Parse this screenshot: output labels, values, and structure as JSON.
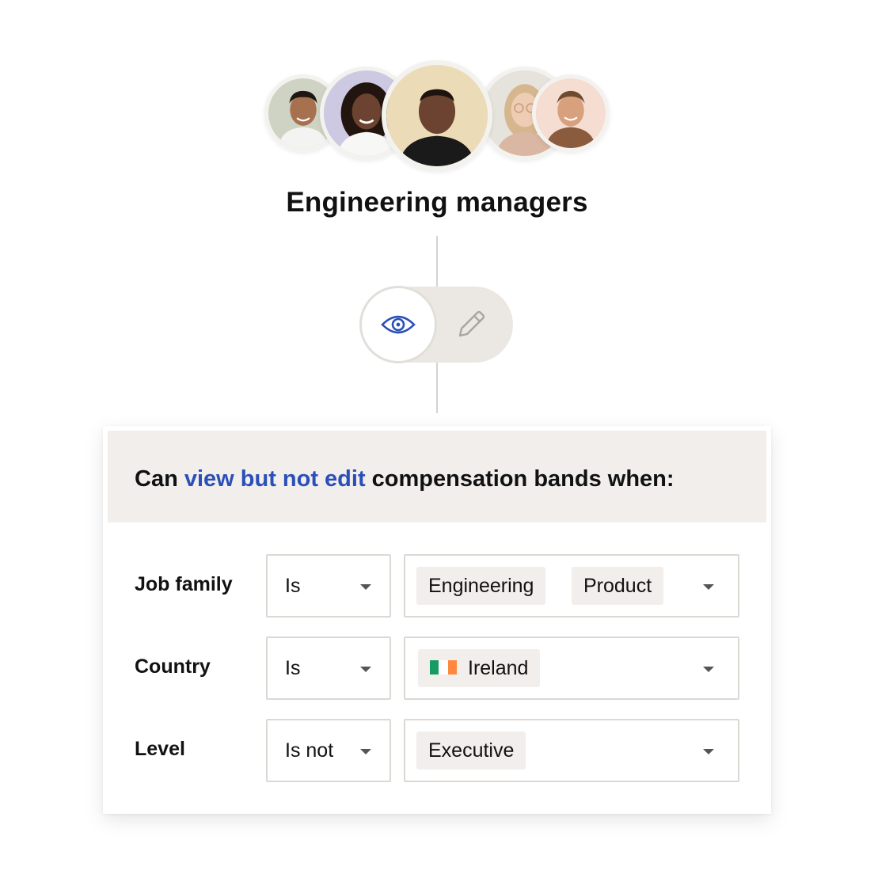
{
  "group": {
    "title": "Engineering managers",
    "members": [
      {
        "name": "avatar-1"
      },
      {
        "name": "avatar-2"
      },
      {
        "name": "avatar-3"
      },
      {
        "name": "avatar-4"
      },
      {
        "name": "avatar-5"
      }
    ]
  },
  "permission_toggle": {
    "selected": "view",
    "options": [
      {
        "icon": "eye-icon",
        "state": "active"
      },
      {
        "icon": "pencil-icon",
        "state": "inactive"
      }
    ]
  },
  "rule": {
    "prefix": "Can ",
    "highlight": "view but not edit",
    "suffix": " compensation bands when:"
  },
  "conditions": [
    {
      "label": "Job family",
      "operator": "Is",
      "values": [
        "Engineering",
        "Product"
      ]
    },
    {
      "label": "Country",
      "operator": "Is",
      "values": [
        "Ireland"
      ],
      "flag": "ireland-flag-icon"
    },
    {
      "label": "Level",
      "operator": "Is not",
      "values": [
        "Executive"
      ]
    }
  ],
  "colors": {
    "accent": "#2b4fb8",
    "header_bg": "#f1eeeb",
    "chip_bg": "#f1eeeb",
    "toggle_bg": "#ebe8e4",
    "border": "#dcd9d5",
    "flag_green": "#169b62",
    "flag_orange": "#ff883e"
  }
}
